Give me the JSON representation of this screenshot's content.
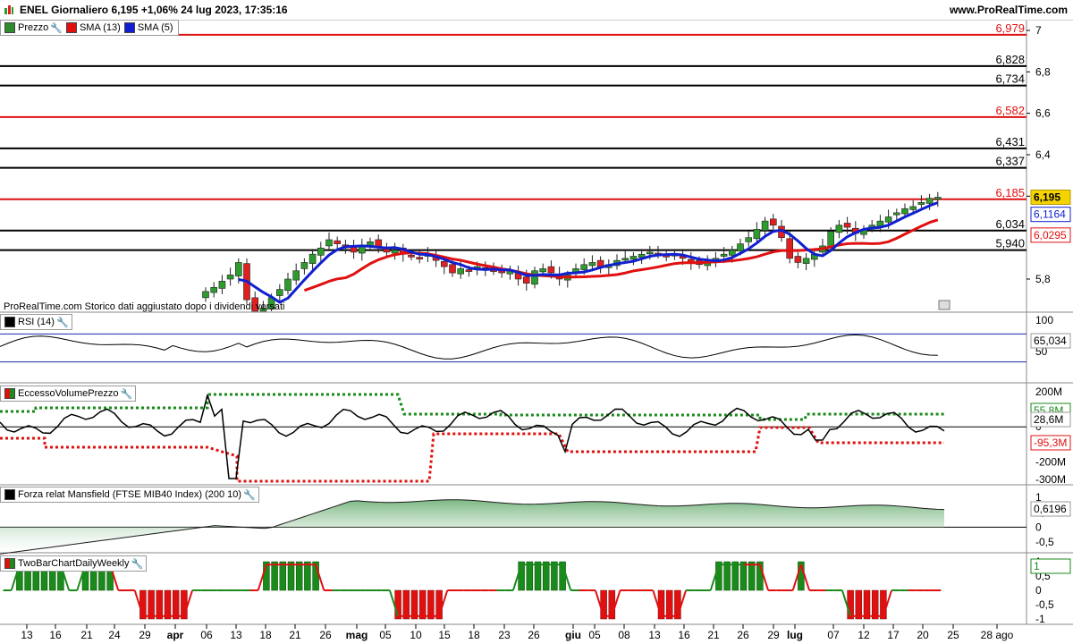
{
  "header": {
    "title": "ENEL Giornaliero 6,195 +1,06% 24 lug 2023, 17:35:16",
    "site": "www.ProRealTime.com"
  },
  "main_panel": {
    "legend": [
      {
        "label": "Prezzo",
        "color": "#2e8b2e"
      },
      {
        "label": "SMA (13)",
        "color": "#e01010"
      },
      {
        "label": "SMA (5)",
        "color": "#1020d0"
      }
    ],
    "watermark": "ProRealTime.com  Storico dati aggiustato dopo i dividendi versati",
    "y_axis_ticks": [
      "7",
      "6,8",
      "6,6",
      "6,4",
      "6,2",
      "5,8"
    ],
    "levels": [
      {
        "value": 6.979,
        "label": "6,979",
        "color": "#e01010"
      },
      {
        "value": 6.828,
        "label": "6,828",
        "color": "#000000"
      },
      {
        "value": 6.734,
        "label": "6,734",
        "color": "#000000"
      },
      {
        "value": 6.582,
        "label": "6,582",
        "color": "#e01010"
      },
      {
        "value": 6.431,
        "label": "6,431",
        "color": "#000000"
      },
      {
        "value": 6.337,
        "label": "6,337",
        "color": "#000000"
      },
      {
        "value": 6.185,
        "label": "6,185",
        "color": "#e01010"
      },
      {
        "value": 6.034,
        "label": "6,034",
        "color": "#000000"
      },
      {
        "value": 5.94,
        "label": "5,940",
        "color": "#000000"
      }
    ],
    "price_tag": "6,195",
    "sma5_tag": "6,1164",
    "sma13_tag": "6,0295"
  },
  "rsi_panel": {
    "label": "RSI (14)",
    "tick_top": "100",
    "tick_mid": "50",
    "value_tag": "65,034"
  },
  "volume_panel": {
    "label": "EccessoVolumePrezzo",
    "ticks": [
      "200M",
      "100M",
      "0",
      "-100M",
      "-200M",
      "-300M"
    ],
    "tag_green": "55,8M",
    "tag_black": "28,6M",
    "tag_red": "-95,3M"
  },
  "mansfield_panel": {
    "label": "Forza relat Mansfield (FTSE MIB40 Index) (200 10)",
    "ticks": [
      "1",
      "0,5",
      "0",
      "-0,5"
    ],
    "value_tag": "0,6196"
  },
  "twobar_panel": {
    "label": "TwoBarChartDailyWeekly",
    "ticks": [
      "1",
      "0,5",
      "0",
      "-0,5",
      "-1"
    ],
    "tag": "1"
  },
  "x_axis": {
    "labels": [
      "13",
      "16",
      "21",
      "24",
      "29",
      "apr",
      "06",
      "13",
      "18",
      "21",
      "26",
      "mag",
      "05",
      "10",
      "15",
      "18",
      "23",
      "26",
      "giu",
      "05",
      "08",
      "13",
      "16",
      "21",
      "26",
      "29",
      "lug",
      "07",
      "12",
      "17",
      "20",
      "25",
      "28 ago"
    ]
  },
  "colors": {
    "up_candle": "#2e9b2e",
    "down_candle": "#e02020",
    "sma13": "#e01010",
    "sma5": "#1020d0",
    "volume_green": "#1a8a1a",
    "volume_red": "#e01010"
  }
}
